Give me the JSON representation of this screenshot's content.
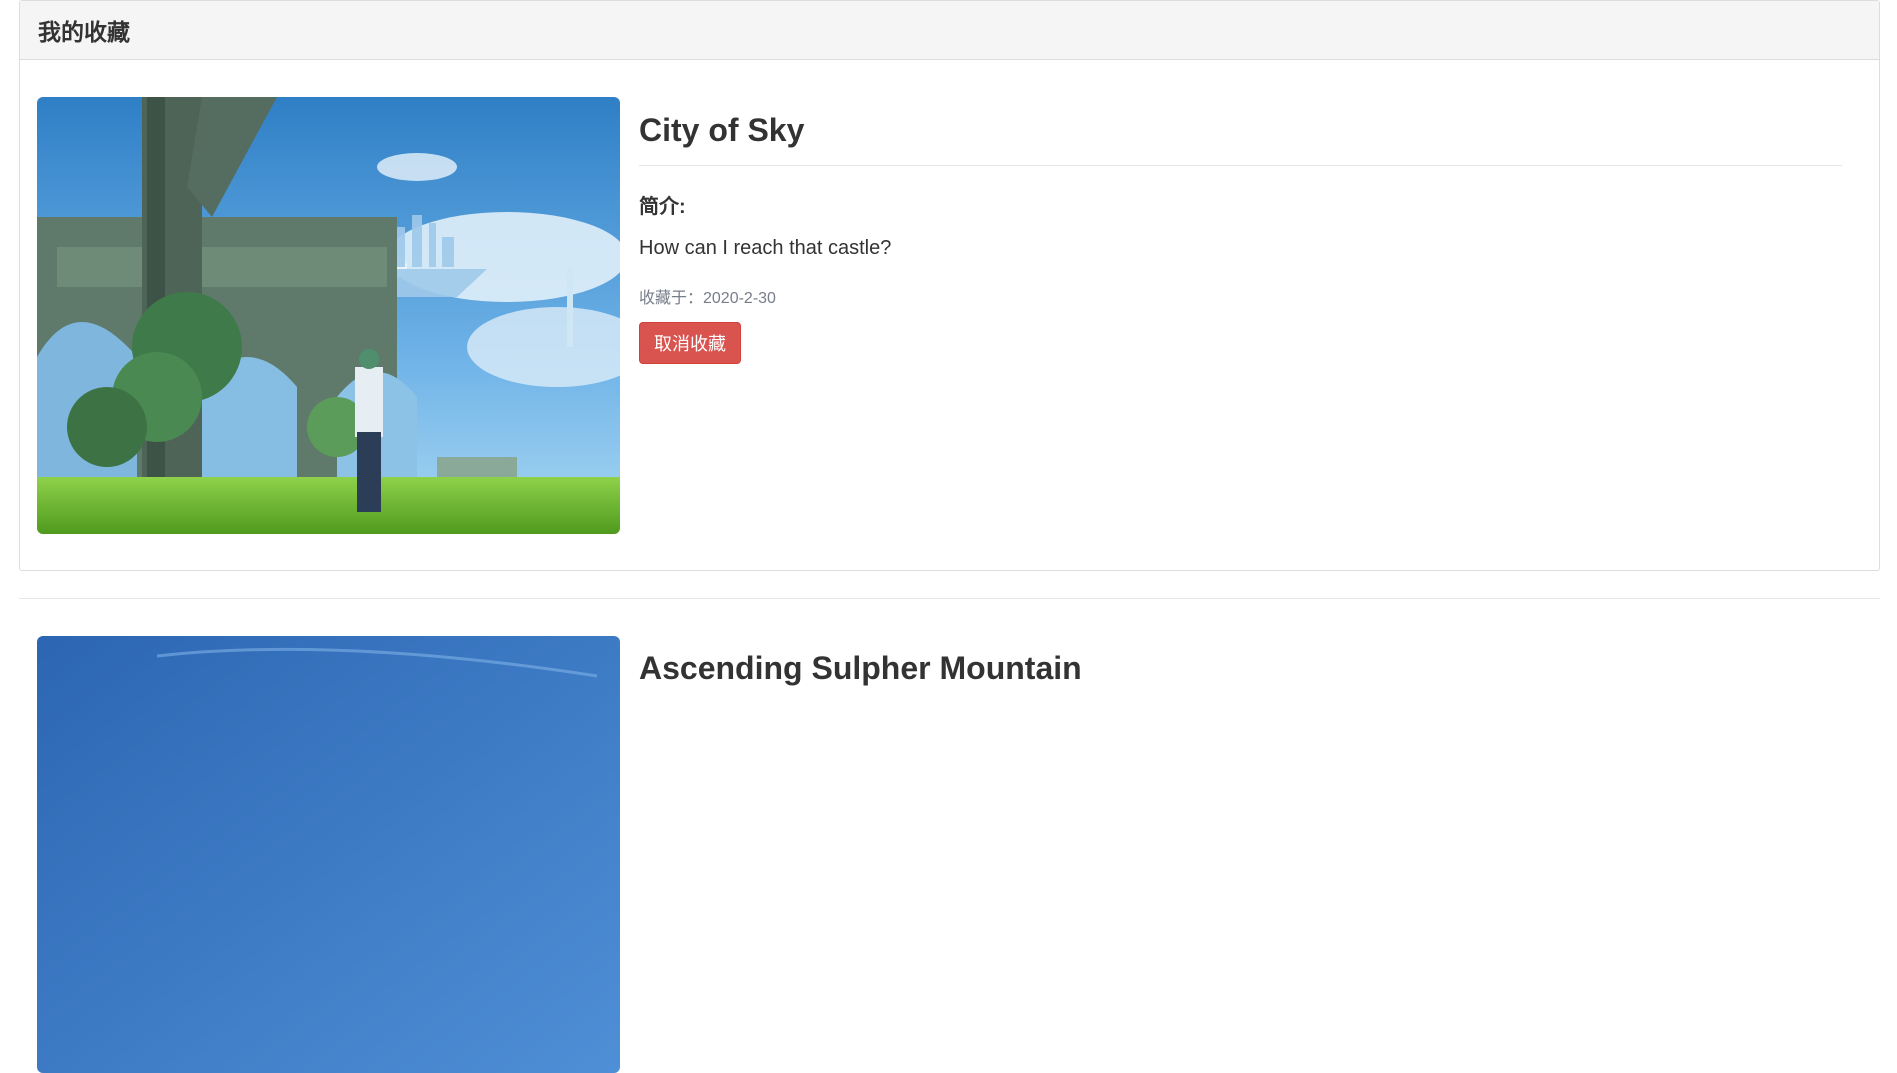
{
  "panel": {
    "heading": "我的收藏"
  },
  "favorites": [
    {
      "title": "City of Sky",
      "desc_label": "简介:",
      "desc": "How can I reach that castle?",
      "date_line": "收藏于：2020-2-30",
      "unfav_label": "取消收藏"
    },
    {
      "title": "Ascending Sulpher Mountain"
    }
  ],
  "colors": {
    "danger": "#d9534f",
    "panel_heading_bg": "#f5f5f5",
    "muted_text": "#777d89"
  }
}
